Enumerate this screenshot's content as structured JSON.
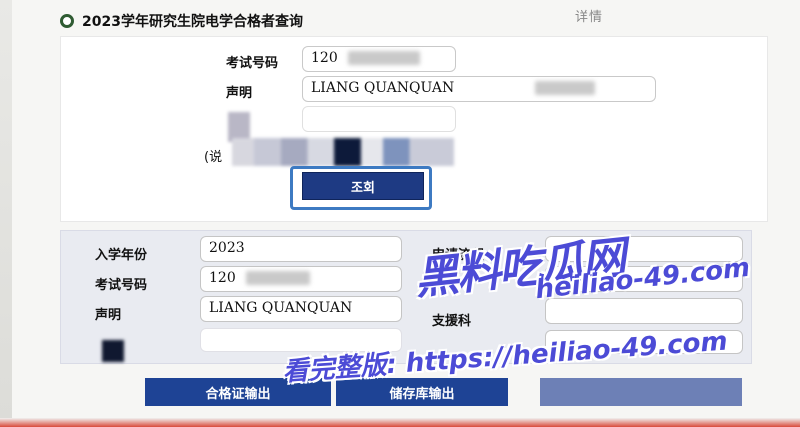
{
  "title": "2023学年研究生院电学合格者查询",
  "corner_text": "详情",
  "top_form": {
    "exam_number_label": "考试号码",
    "exam_number_value": "120",
    "name_label": "声明",
    "name_value": "LIANG QUANQUAN",
    "name_extra": "",
    "note_label": "(说",
    "search_button": "조회"
  },
  "bottom_form": {
    "year_label": "入学年份",
    "year_value": "2023",
    "exam_number_label": "考试号码",
    "exam_number_value": "120",
    "name_label": "声明",
    "name_value": "LIANG QUANQUAN",
    "apply_process_label": "申请流程",
    "support_label": "支援科"
  },
  "buttons": {
    "certificate_output": "合格证输出",
    "archive_output": "储存库输出",
    "disabled_button": ""
  },
  "watermark": {
    "brand": "黑料吃瓜网",
    "domain": "heiliao-49.com",
    "promo": "看完整版: https://heiliao-49.com"
  }
}
